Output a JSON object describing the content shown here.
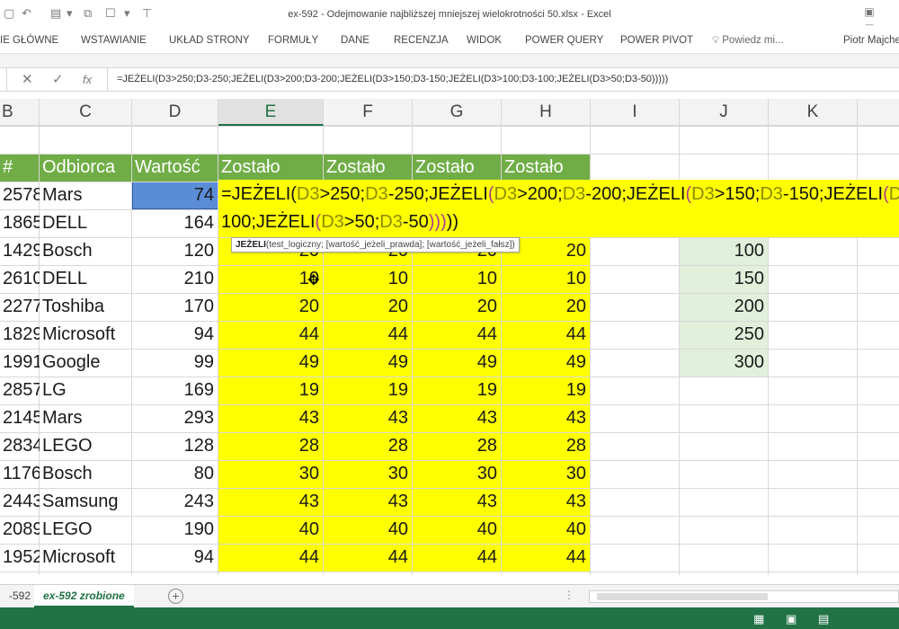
{
  "window": {
    "title": "ex-592 - Odejmowanie najbliższej mniejszej wielokrotności 50.xlsx - Excel",
    "qa_icons": [
      "save-icon",
      "undo-icon",
      "redo-icon",
      "sort-icon",
      "network-icon",
      "touch-mode-icon",
      "customize-icon"
    ],
    "controls": {
      "restore": "▣",
      "minimize": "—"
    }
  },
  "ribbon": {
    "tabs": [
      "IE GŁÓWNE",
      "WSTAWIANIE",
      "UKŁAD STRONY",
      "FORMUŁY",
      "DANE",
      "RECENZJA",
      "WIDOK",
      "POWER QUERY",
      "POWER PIVOT"
    ],
    "tell_me": "Powiedz mi...",
    "user": "Piotr Majche"
  },
  "formula_bar": {
    "cancel": "✕",
    "enter": "✓",
    "fx": "fx",
    "text": "=JEŻELI(D3>250;D3-250;JEŻELI(D3>200;D3-200;JEŻELI(D3>150;D3-150;JEŻELI(D3>100;D3-100;JEŻELI(D3>50;D3-50)))))"
  },
  "columns": [
    "B",
    "C",
    "D",
    "E",
    "F",
    "G",
    "H",
    "I",
    "J",
    "K"
  ],
  "active_column": "E",
  "table": {
    "headers": {
      "b": "#",
      "c": "Odbiorca",
      "d": "Wartość",
      "e": "Zostało",
      "f": "Zostało",
      "g": "Zostało",
      "h": "Zostało"
    },
    "rows": [
      {
        "b": "2578",
        "c": "Mars",
        "d": "74",
        "e": "",
        "f": "",
        "g": "",
        "h": ""
      },
      {
        "b": "1865",
        "c": "DELL",
        "d": "164",
        "e": "",
        "f": "",
        "g": "",
        "h": ""
      },
      {
        "b": "1429",
        "c": "Bosch",
        "d": "120",
        "e": "20",
        "f": "20",
        "g": "20",
        "h": "20"
      },
      {
        "b": "2610",
        "c": "DELL",
        "d": "210",
        "e": "10",
        "f": "10",
        "g": "10",
        "h": "10"
      },
      {
        "b": "2277",
        "c": "Toshiba",
        "d": "170",
        "e": "20",
        "f": "20",
        "g": "20",
        "h": "20"
      },
      {
        "b": "1829",
        "c": "Microsoft",
        "d": "94",
        "e": "44",
        "f": "44",
        "g": "44",
        "h": "44"
      },
      {
        "b": "1991",
        "c": "Google",
        "d": "99",
        "e": "49",
        "f": "49",
        "g": "49",
        "h": "49"
      },
      {
        "b": "2857",
        "c": "LG",
        "d": "169",
        "e": "19",
        "f": "19",
        "g": "19",
        "h": "19"
      },
      {
        "b": "2145",
        "c": "Mars",
        "d": "293",
        "e": "43",
        "f": "43",
        "g": "43",
        "h": "43"
      },
      {
        "b": "2834",
        "c": "LEGO",
        "d": "128",
        "e": "28",
        "f": "28",
        "g": "28",
        "h": "28"
      },
      {
        "b": "1176",
        "c": "Bosch",
        "d": "80",
        "e": "30",
        "f": "30",
        "g": "30",
        "h": "30"
      },
      {
        "b": "2443",
        "c": "Samsung",
        "d": "243",
        "e": "43",
        "f": "43",
        "g": "43",
        "h": "43"
      },
      {
        "b": "2089",
        "c": "LEGO",
        "d": "190",
        "e": "40",
        "f": "40",
        "g": "40",
        "h": "40"
      },
      {
        "b": "1952",
        "c": "Microsoft",
        "d": "94",
        "e": "44",
        "f": "44",
        "g": "44",
        "h": "44"
      }
    ]
  },
  "thresholds": [
    "100",
    "150",
    "200",
    "250",
    "300"
  ],
  "edit": {
    "line1": [
      {
        "t": "=JEŻELI(",
        "c": "n"
      },
      {
        "t": "D3",
        "c": "r"
      },
      {
        "t": ">250;",
        "c": "n"
      },
      {
        "t": "D3",
        "c": "r"
      },
      {
        "t": "-250;JEŻELI",
        "c": "n"
      },
      {
        "t": "(",
        "c": "p"
      },
      {
        "t": "D3",
        "c": "r"
      },
      {
        "t": ">200;",
        "c": "n"
      },
      {
        "t": "D3",
        "c": "r"
      },
      {
        "t": "-200;JEŻELI",
        "c": "n"
      },
      {
        "t": "(",
        "c": "p"
      },
      {
        "t": "D3",
        "c": "r"
      },
      {
        "t": ">150;",
        "c": "n"
      },
      {
        "t": "D3",
        "c": "r"
      },
      {
        "t": "-150;JEŻELI",
        "c": "n"
      },
      {
        "t": "(",
        "c": "p"
      },
      {
        "t": "D3",
        "c": "r"
      },
      {
        "t": ">1",
        "c": "n"
      }
    ],
    "line2": [
      {
        "t": "100;JEŻELI",
        "c": "n"
      },
      {
        "t": "(",
        "c": "p"
      },
      {
        "t": "D3",
        "c": "r"
      },
      {
        "t": ">50;",
        "c": "n"
      },
      {
        "t": "D3",
        "c": "r"
      },
      {
        "t": "-50",
        "c": "n"
      },
      {
        "t": ")",
        "c": "p"
      },
      {
        "t": ")",
        "c": "p"
      },
      {
        "t": ")",
        "c": "p"
      },
      {
        "t": ")",
        "c": "n"
      },
      {
        "t": ")",
        "c": "n"
      }
    ]
  },
  "tooltip": {
    "fn": "JEŻELI",
    "args": "(test_logiczny; [wartość_jeżeli_prawda]; [wartość_jeżeli_fałsz])"
  },
  "sheets": {
    "tabs": [
      "-592",
      "ex-592 zrobione"
    ],
    "active": 1,
    "add": "+",
    "more": "⋮"
  },
  "status_bar": {
    "view_icons": [
      "normal-view-icon",
      "page-layout-icon",
      "page-break-icon"
    ]
  },
  "colors": {
    "header_green": "#70ad47",
    "yellow": "#ffff00",
    "light_green": "#e2efda",
    "selected_blue": "#5b8cd6",
    "excel_green": "#217346"
  }
}
